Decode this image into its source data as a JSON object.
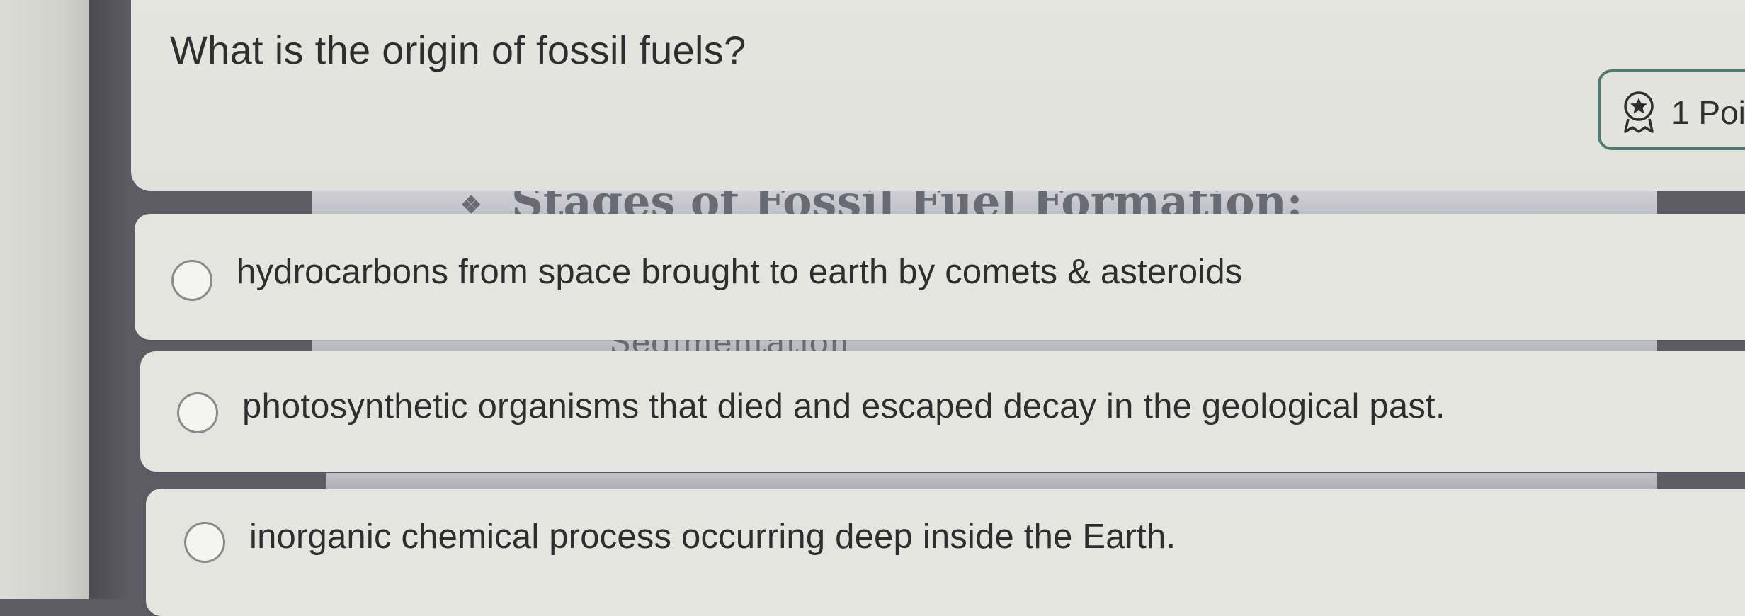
{
  "question": {
    "text": "What is the origin of fossil fuels?"
  },
  "points": {
    "label": "1 Poi",
    "icon": "award-ribbon-icon"
  },
  "background_slide": {
    "heading": "Stages of Fossil Fuel Formation:",
    "bullet_icon": "diamond-bullet-icon",
    "subheading": "Sedimentation"
  },
  "options": [
    {
      "label": "hydrocarbons from space brought to earth by comets & asteroids",
      "selected": false
    },
    {
      "label": "photosynthetic organisms that died and escaped decay in the geological past.",
      "selected": false
    },
    {
      "label": "inorganic chemical process occurring deep inside the Earth.",
      "selected": false
    }
  ],
  "colors": {
    "card": "#e5e5df",
    "badge_border": "#4f7b70",
    "text": "#2e2e30"
  }
}
